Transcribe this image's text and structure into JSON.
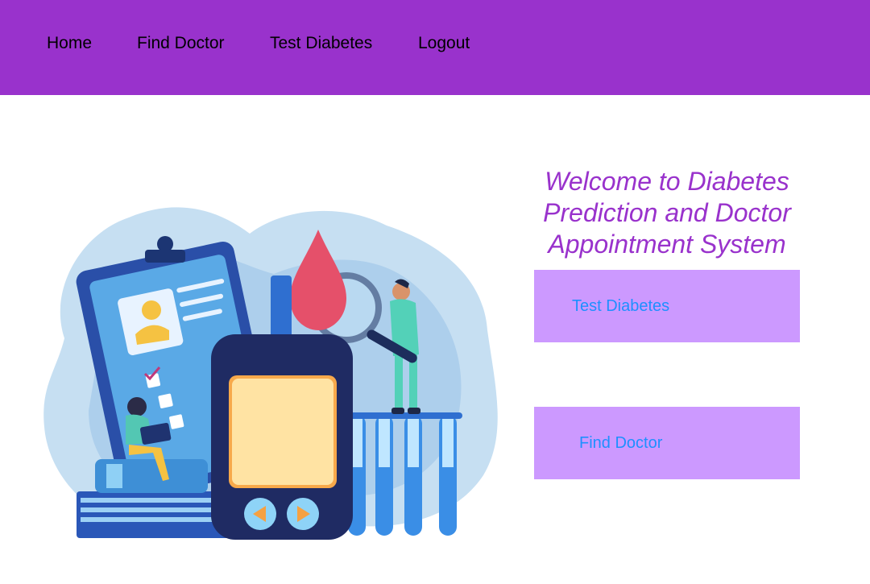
{
  "nav": {
    "home": "Home",
    "find_doctor": "Find Doctor",
    "test_diabetes": "Test Diabetes",
    "logout": "Logout"
  },
  "hero": {
    "title": "Welcome to Diabetes Prediction and Doctor Appointment System",
    "illustration": "diabetes-glucose-meter-illustration"
  },
  "actions": {
    "test_diabetes": "Test Diabetes",
    "find_doctor": "Find Doctor"
  },
  "colors": {
    "navbar": "#9932cc",
    "title": "#9932cc",
    "card": "#cc99ff",
    "link": "#1e90ff"
  }
}
